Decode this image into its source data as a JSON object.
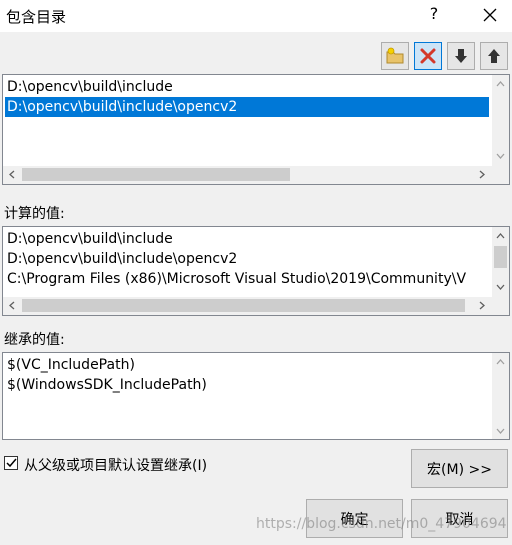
{
  "window": {
    "title": "包含目录",
    "help": "?",
    "close": "✕"
  },
  "include_dirs": {
    "items": [
      {
        "text": "D:\\opencv\\build\\include",
        "selected": false
      },
      {
        "text": "D:\\opencv\\build\\include\\opencv2",
        "selected": true
      }
    ]
  },
  "computed": {
    "label": "计算的值:",
    "lines": [
      "D:\\opencv\\build\\include",
      "D:\\opencv\\build\\include\\opencv2",
      "C:\\Program Files (x86)\\Microsoft Visual Studio\\2019\\Community\\V"
    ]
  },
  "inherited": {
    "label": "继承的值:",
    "lines": [
      "$(VC_IncludePath)",
      "$(WindowsSDK_IncludePath)"
    ]
  },
  "inherit_checkbox": {
    "label": "从父级或项目默认设置继承(I)",
    "checked": true
  },
  "buttons": {
    "macro": "宏(M) >>",
    "ok": "确定",
    "cancel": "取消"
  },
  "watermark": "https://blog.csdn.net/m0_47904694",
  "colors": {
    "selection": "#0078d7",
    "delete_icon": "#d4382b",
    "background": "#f0f0f0"
  }
}
